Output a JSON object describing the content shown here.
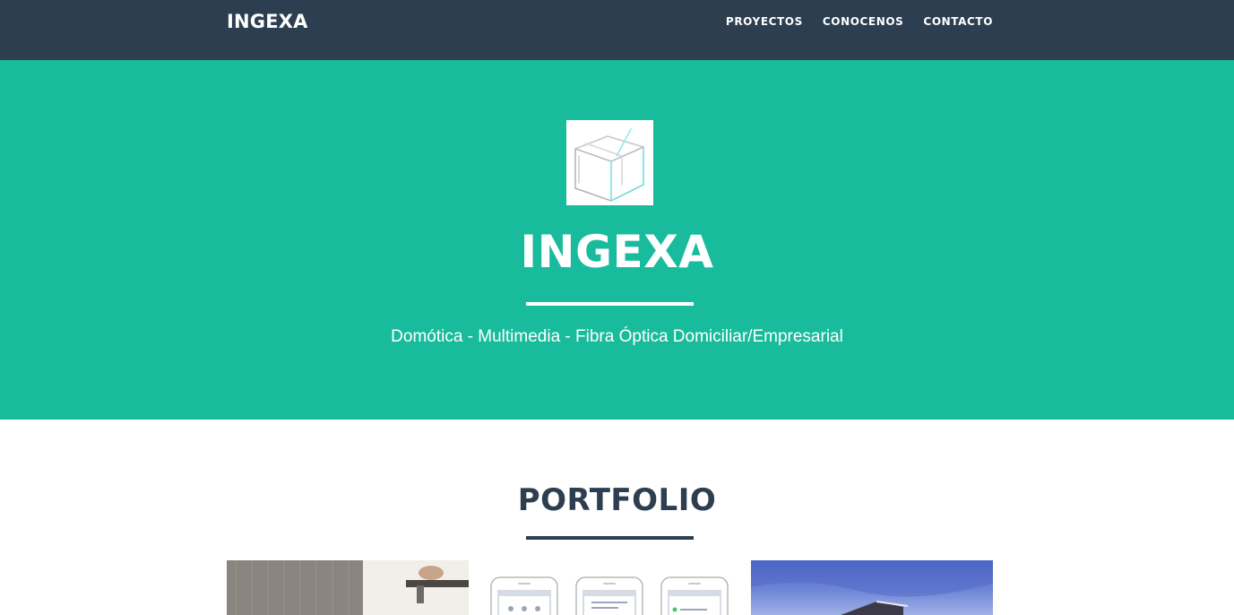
{
  "navbar": {
    "brand": "INGEXA",
    "links": [
      {
        "label": "PROYECTOS"
      },
      {
        "label": "CONOCENOS"
      },
      {
        "label": "CONTACTO"
      }
    ]
  },
  "masthead": {
    "logo_icon": "cube-logo-icon",
    "title": "INGEXA",
    "subtitle": "Domótica - Multimedia - Fibra Óptica Domiciliar/Empresarial"
  },
  "portfolio": {
    "title": "PORTFOLIO",
    "items": [
      {
        "icon": "interior-photo"
      },
      {
        "icon": "phone-app-screens"
      },
      {
        "icon": "building-photo"
      }
    ]
  },
  "colors": {
    "navbar": "#2c3e50",
    "accent": "#18bc9c",
    "text": "#2c3e50"
  }
}
